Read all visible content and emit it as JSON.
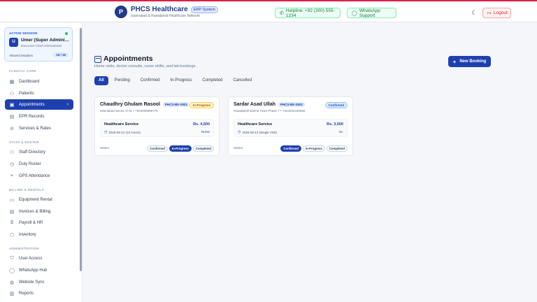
{
  "header": {
    "logo_text": "P",
    "title": "PHCS Healthcare",
    "badge": "ERP System",
    "subtitle": "Islamabad & Rawalpindi Healthcare Network",
    "helpline": "Helpline: +92 (300) 555-1234",
    "whatsapp": "WhatsApp Support",
    "logout": "Logout"
  },
  "session": {
    "label": "ACTIVE SESSION",
    "avatar": "U",
    "name": "Umer (Super Administrator)",
    "role": "Executive Chief Administrator",
    "modules_label": "Allowed Modules",
    "modules_count": "16 / 16"
  },
  "sidebar": {
    "sections": {
      "clinical": "CLINICAL CARE",
      "staff": "STAFF & ROSTER",
      "billing": "BILLING & RENTALS",
      "admin": "ADMINISTRATION"
    },
    "items": [
      {
        "label": "Dashboard",
        "icon": "dashboard-icon",
        "glyph": "▦"
      },
      {
        "label": "Patients",
        "icon": "users-icon",
        "glyph": "⚇"
      },
      {
        "label": "Appointments",
        "icon": "calendar-icon",
        "glyph": "▣"
      },
      {
        "label": "EPR Records",
        "icon": "file-icon",
        "glyph": "▤"
      },
      {
        "label": "Services & Rates",
        "icon": "tag-icon",
        "glyph": "⊘"
      },
      {
        "label": "Staff Directory",
        "icon": "staff-icon",
        "glyph": "⚇"
      },
      {
        "label": "Duty Roster",
        "icon": "clock-icon",
        "glyph": "◷"
      },
      {
        "label": "GPS Attendance",
        "icon": "pin-icon",
        "glyph": "⌖"
      },
      {
        "label": "Equipment Rental",
        "icon": "bed-icon",
        "glyph": "▭"
      },
      {
        "label": "Invoices & Billing",
        "icon": "receipt-icon",
        "glyph": "▤"
      },
      {
        "label": "Payroll & HR",
        "icon": "dollar-icon",
        "glyph": "$"
      },
      {
        "label": "Inventory",
        "icon": "box-icon",
        "glyph": "⬡"
      },
      {
        "label": "User Access",
        "icon": "shield-icon",
        "glyph": "⛉"
      },
      {
        "label": "WhatsApp Hub",
        "icon": "chat-icon",
        "glyph": "◯"
      },
      {
        "label": "Website Sync",
        "icon": "globe-icon",
        "glyph": "◍"
      },
      {
        "label": "Reports",
        "icon": "chart-icon",
        "glyph": "▥"
      }
    ]
  },
  "page": {
    "title": "Appointments",
    "subtitle": "Home visits, doctor consults, nurse shifts, and lab bookings.",
    "new_booking": "New Booking",
    "tabs": [
      "All",
      "Pending",
      "Confirmed",
      "In-Progress",
      "Completed",
      "Cancelled"
    ],
    "status_label": "Status:",
    "service_label": "Healthcare Service",
    "status_options": [
      "Confirmed",
      "In-Progress",
      "Completed"
    ]
  },
  "cards": [
    {
      "name": "Chaudhry Ghulam Rasool",
      "id": "PHCS-BK-0001",
      "location": "Islamabad Sector G-11 • +923009988776",
      "status": "In-Progress",
      "price": "Rs. 4,500",
      "date": "2026-08-12 (12 Hours)",
      "role": "Nurse"
    },
    {
      "name": "Sardar Asad Ullah",
      "id": "PHCS-BK-0002",
      "location": "Rawalpindi Bahria Town Phase 7 • +923334445566",
      "status": "Confirmed",
      "price": "Rs. 3,500",
      "date": "2026-08-13 (Single Visit)",
      "role": "Dr."
    }
  ]
}
